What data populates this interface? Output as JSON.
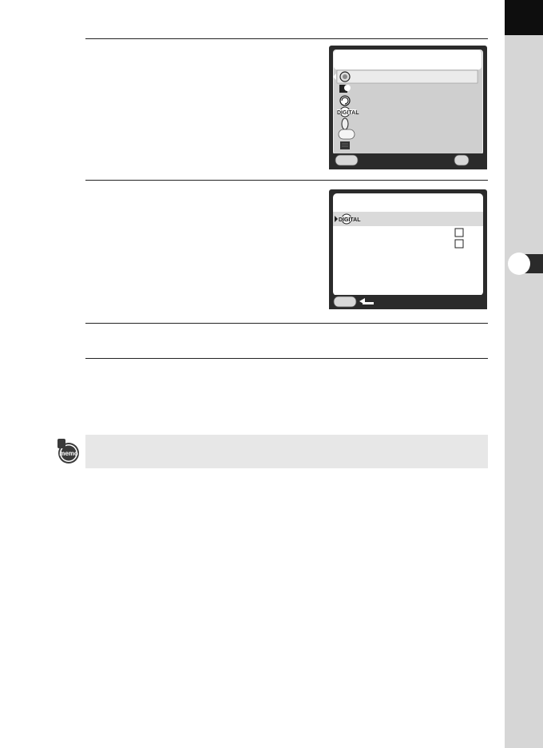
{
  "page": {
    "side_colors": {
      "strip": "#d6d6d6",
      "tab": "#0e0e0e"
    }
  },
  "screens": [
    {
      "name": "digital-filter-menu",
      "rows": [
        {
          "icon": "circle-icon"
        },
        {
          "icon": "custom-image-icon"
        },
        {
          "icon": "rotate-icon"
        },
        {
          "icon": "digital-filter-icon"
        },
        {
          "icon": "oval-icon"
        },
        {
          "icon": "rounded-rect-icon"
        },
        {
          "icon": "grid-icon"
        }
      ]
    },
    {
      "name": "digital-filter-submenu",
      "rows": [
        {
          "icon": "digital-filter-icon"
        },
        {
          "icon": "checkbox-icon"
        },
        {
          "icon": "checkbox-icon"
        }
      ]
    }
  ],
  "memo": {
    "icon_label": "memo"
  }
}
